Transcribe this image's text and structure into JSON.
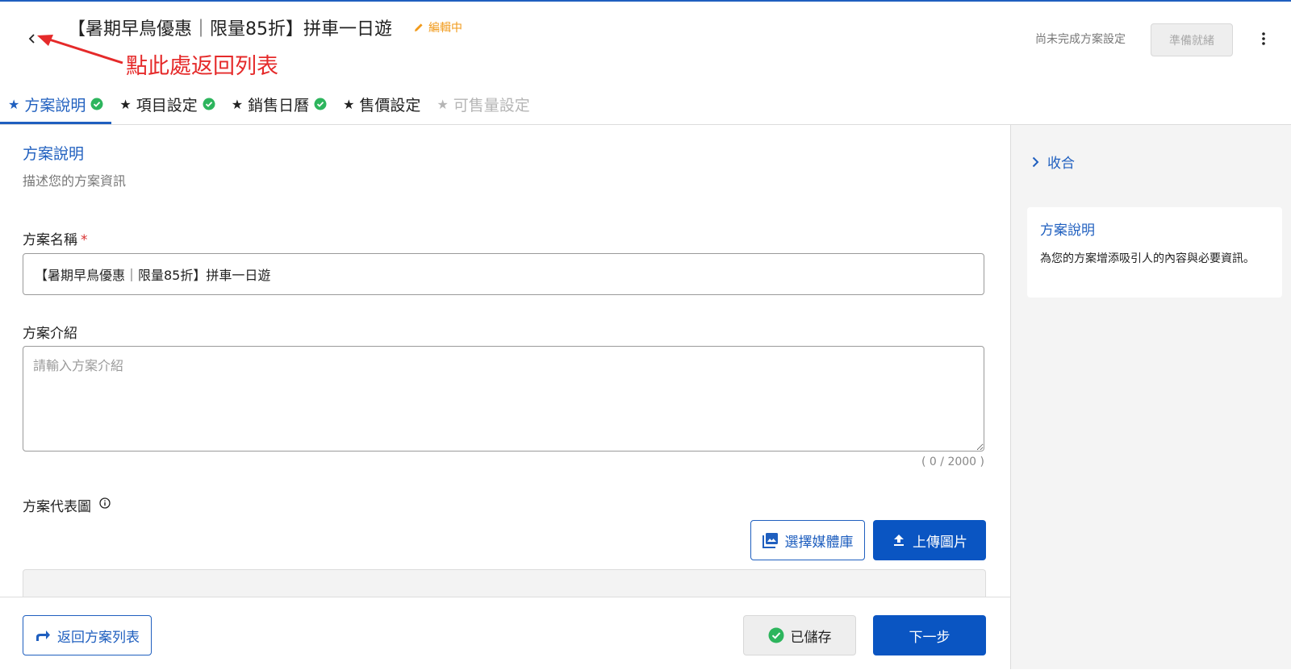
{
  "header": {
    "plan_title": "【暑期早鳥優惠｜限量85折】拼車一日遊",
    "edit_status": "編輯中",
    "annotation": "點此處返回列表",
    "completion_status": "尚未完成方案設定",
    "ready_button": "準備就緒"
  },
  "tabs": [
    {
      "label": "方案說明",
      "state": "active",
      "done": true
    },
    {
      "label": "項目設定",
      "state": "normal",
      "done": true
    },
    {
      "label": "銷售日曆",
      "state": "normal",
      "done": true
    },
    {
      "label": "售價設定",
      "state": "normal",
      "done": false
    },
    {
      "label": "可售量設定",
      "state": "disabled",
      "done": false
    }
  ],
  "form": {
    "section_title": "方案說明",
    "section_subtitle": "描述您的方案資訊",
    "name_label": "方案名稱",
    "required_mark": "*",
    "name_value": "【暑期早鳥優惠｜限量85折】拼車一日遊",
    "intro_label": "方案介紹",
    "intro_placeholder": "請輸入方案介紹",
    "intro_value": "",
    "intro_counter": "( 0 / 2000 )",
    "image_label": "方案代表圖",
    "media_button": "選擇媒體庫",
    "upload_button": "上傳圖片"
  },
  "footer": {
    "back_list_button": "返回方案列表",
    "saved_button": "已儲存",
    "next_button": "下一步"
  },
  "side_panel": {
    "collapse_label": "收合",
    "card_title": "方案說明",
    "card_desc": "為您的方案增添吸引人的內容與必要資訊。"
  },
  "colors": {
    "primary": "#0a55c2",
    "link": "#1f5fbf",
    "edit_orange": "#f19a1a",
    "annotation_red": "#e52a2a",
    "check_green": "#2db55d"
  }
}
